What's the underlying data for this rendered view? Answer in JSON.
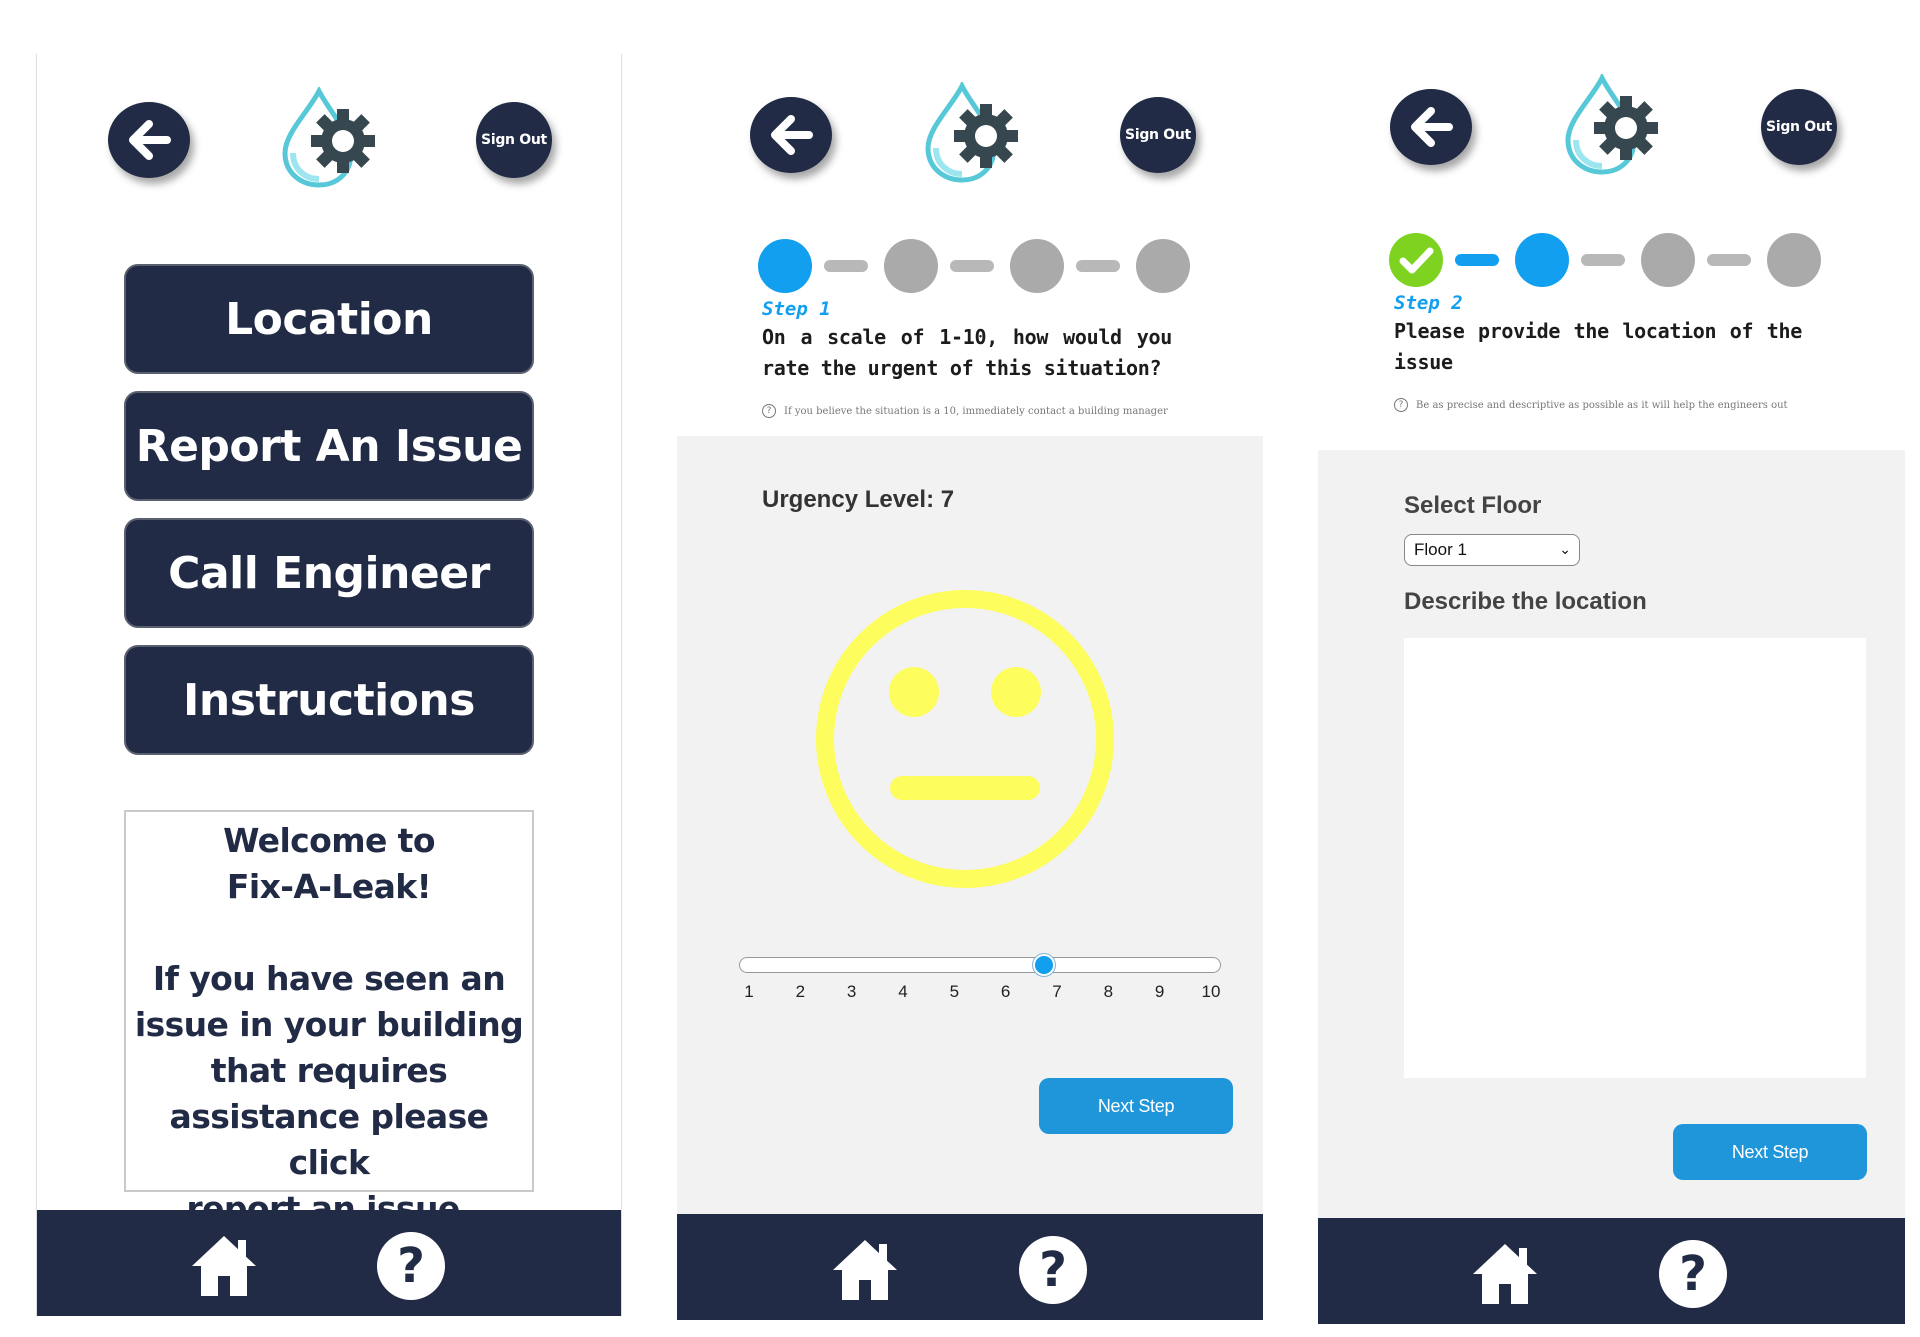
{
  "header": {
    "sign_out_label": "Sign Out",
    "back_icon": "arrow-left-icon",
    "logo_icon": "water-drop-gear-logo"
  },
  "screen1": {
    "menu": [
      "Location",
      "Report An Issue",
      "Call Engineer",
      "Instructions"
    ],
    "welcome_title_1": "Welcome to",
    "welcome_title_2": "Fix-A-Leak!",
    "welcome_lines": [
      "If you have seen an",
      "issue in your building",
      "that requires",
      "assistance please click",
      "report an issue."
    ]
  },
  "screen2": {
    "step_label": "Step 1",
    "question": "On a scale of 1-10, how would you rate the urgent of this situation?",
    "hint": "If you believe the situation is a 10, immediately contact a building manager",
    "urgency_label": "Urgency Level: 7",
    "urgency_value": 7,
    "slider_min": 1,
    "slider_max": 10,
    "ticks": [
      "1",
      "2",
      "3",
      "4",
      "5",
      "6",
      "7",
      "8",
      "9",
      "10"
    ],
    "next_label": "Next Step",
    "face_icon": "neutral-face-icon"
  },
  "screen3": {
    "step_label": "Step 2",
    "question": "Please provide the location of the issue",
    "hint": "Be as precise and descriptive as possible as it will help the engineers out",
    "floor_label": "Select Floor",
    "floor_value": "Floor 1",
    "describe_label": "Describe the location",
    "describe_value": "",
    "next_label": "Next Step"
  },
  "bottom_nav": {
    "home_icon": "home-icon",
    "help_icon": "help-icon"
  },
  "colors": {
    "navy": "#222b45",
    "step_active": "#129ff0",
    "step_done": "#7ed321",
    "step_inactive": "#aaaaaa",
    "face": "#fdfd5e",
    "button_blue": "#1f96d9"
  }
}
